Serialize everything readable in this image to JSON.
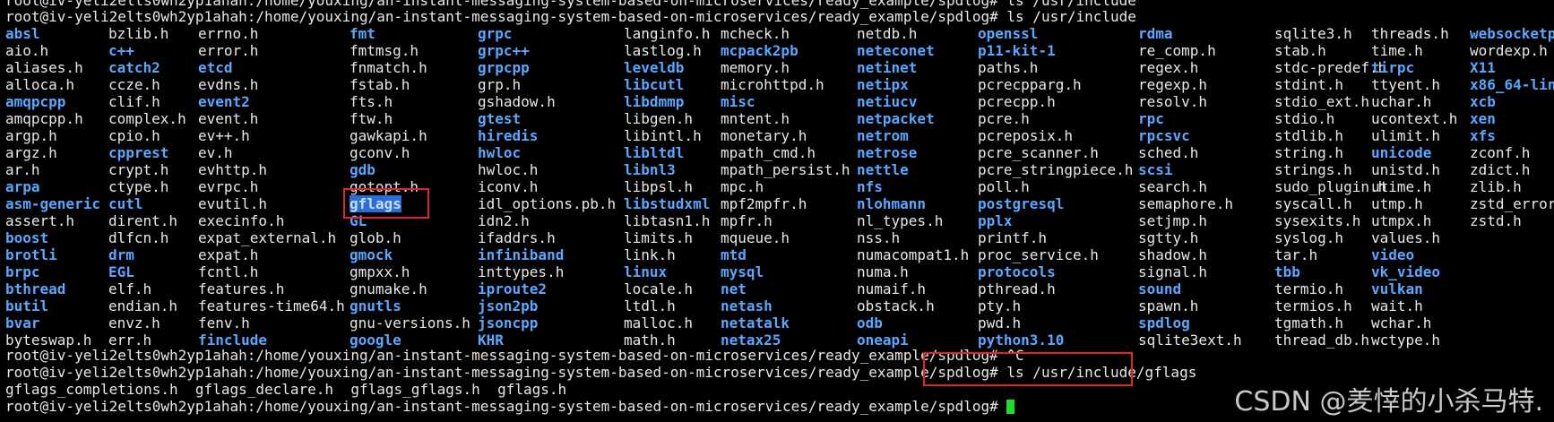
{
  "prompt_top_partial": "root@iv-yeli2elts0wh2yp1ahah:/home/youxing/an-instant-messaging-system-based-on-microservices/ready_example/spdlog# ls /usr/include",
  "prompt_ls_cmd": "root@iv-yeli2elts0wh2yp1ahah:/home/youxing/an-instant-messaging-system-based-on-microservices/ready_example/spdlog# ls /usr/include",
  "listing_columns": [
    [
      "absl",
      "aio.h",
      "aliases.h",
      "alloca.h",
      "amqpcpp",
      "amqpcpp.h",
      "argp.h",
      "argz.h",
      "ar.h",
      "arpa",
      "asm-generic",
      "assert.h",
      "boost",
      "brotli",
      "brpc",
      "bthread",
      "butil",
      "bvar",
      "byteswap.h"
    ],
    [
      "bzlib.h",
      "c++",
      "catch2",
      "ccze.h",
      "clif.h",
      "complex.h",
      "cpio.h",
      "cpprest",
      "crypt.h",
      "ctype.h",
      "cutl",
      "dirent.h",
      "dlfcn.h",
      "drm",
      "EGL",
      "elf.h",
      "endian.h",
      "envz.h",
      "err.h"
    ],
    [
      "errno.h",
      "error.h",
      "etcd",
      "evdns.h",
      "event2",
      "event.h",
      "ev++.h",
      "ev.h",
      "evhttp.h",
      "evrpc.h",
      "evutil.h",
      "execinfo.h",
      "expat_external.h",
      "expat.h",
      "fcntl.h",
      "features.h",
      "features-time64.h",
      "fenv.h",
      "finclude"
    ],
    [
      "fmt",
      "fmtmsg.h",
      "fnmatch.h",
      "fstab.h",
      "fts.h",
      "ftw.h",
      "gawkapi.h",
      "gconv.h",
      "gdb",
      "gotopt.h",
      "gflags",
      "GL",
      "glob.h",
      "gmock",
      "gmpxx.h",
      "gnumake.h",
      "gnutls",
      "gnu-versions.h",
      "google"
    ],
    [
      "grpc",
      "grpc++",
      "grpcpp",
      "grp.h",
      "gshadow.h",
      "gtest",
      "hiredis",
      "hwloc",
      "hwloc.h",
      "iconv.h",
      "idl_options.pb.h",
      "idn2.h",
      "ifaddrs.h",
      "infiniband",
      "inttypes.h",
      "iproute2",
      "json2pb",
      "jsoncpp",
      "KHR"
    ],
    [
      "langinfo.h",
      "lastlog.h",
      "leveldb",
      "libcutl",
      "libdmmp",
      "libgen.h",
      "libintl.h",
      "libltdl",
      "libnl3",
      "libpsl.h",
      "libstudxml",
      "libtasn1.h",
      "limits.h",
      "link.h",
      "linux",
      "locale.h",
      "ltdl.h",
      "malloc.h",
      "math.h"
    ],
    [
      "mcheck.h",
      "mcpack2pb",
      "memory.h",
      "microhttpd.h",
      "misc",
      "mntent.h",
      "monetary.h",
      "mpath_cmd.h",
      "mpath_persist.h",
      "mpc.h",
      "mpf2mpfr.h",
      "mpfr.h",
      "mqueue.h",
      "mtd",
      "mysql",
      "net",
      "netash",
      "netatalk",
      "netax25"
    ],
    [
      "netdb.h",
      "neteconet",
      "netinet",
      "netipx",
      "netiucv",
      "netpacket",
      "netrom",
      "netrose",
      "nettle",
      "nfs",
      "nlohmann",
      "nl_types.h",
      "nss.h",
      "numacompat1.h",
      "numa.h",
      "numaif.h",
      "obstack.h",
      "odb",
      "oneapi"
    ],
    [
      "openssl",
      "p11-kit-1",
      "paths.h",
      "pcrecpparg.h",
      "pcrecpp.h",
      "pcre.h",
      "pcreposix.h",
      "pcre_scanner.h",
      "pcre_stringpiece.h",
      "poll.h",
      "postgresql",
      "pplx",
      "printf.h",
      "proc_service.h",
      "protocols",
      "pthread.h",
      "pty.h",
      "pwd.h",
      "python3.10"
    ],
    [
      "rdma",
      "re_comp.h",
      "regex.h",
      "regexp.h",
      "resolv.h",
      "rpc",
      "rpcsvc",
      "sched.h",
      "scsi",
      "search.h",
      "semaphore.h",
      "setjmp.h",
      "sgtty.h",
      "shadow.h",
      "signal.h",
      "sound",
      "spawn.h",
      "spdlog",
      "sqlite3ext.h"
    ],
    [
      "sqlite3.h",
      "stab.h",
      "stdc-predef.h",
      "stdint.h",
      "stdio_ext.h",
      "stdio.h",
      "stdlib.h",
      "string.h",
      "strings.h",
      "sudo_plugin.h",
      "syscall.h",
      "sysexits.h",
      "syslog.h",
      "tar.h",
      "tbb",
      "termio.h",
      "termios.h",
      "tgmath.h",
      "thread_db.h"
    ],
    [
      "threads.h",
      "time.h",
      "tirpc",
      "ttyent.h",
      "uchar.h",
      "ucontext.h",
      "ulimit.h",
      "unicode",
      "unistd.h",
      "utime.h",
      "utmp.h",
      "utmpx.h",
      "values.h",
      "video",
      "vk_video",
      "vulkan",
      "wait.h",
      "wchar.h",
      "wctype.h"
    ],
    [
      "websocketpp",
      "wordexp.h",
      "X11",
      "x86_64-linux-gnu",
      "xcb",
      "xen",
      "xfs",
      "zconf.h",
      "zdict.h",
      "zlib.h",
      "zstd_errors.h",
      "zstd.h"
    ]
  ],
  "dir_entries": [
    "absl",
    "amqpcpp",
    "arpa",
    "asm-generic",
    "boost",
    "brotli",
    "brpc",
    "bthread",
    "butil",
    "bvar",
    "c++",
    "catch2",
    "cpprest",
    "cutl",
    "drm",
    "EGL",
    "etcd",
    "event2",
    "finclude",
    "fmt",
    "gdb",
    "gflags",
    "GL",
    "gmock",
    "gnutls",
    "google",
    "grpc",
    "grpc++",
    "grpcpp",
    "gtest",
    "hiredis",
    "hwloc",
    "infiniband",
    "iproute2",
    "json2pb",
    "jsoncpp",
    "KHR",
    "leveldb",
    "libcutl",
    "libdmmp",
    "libltdl",
    "libnl3",
    "libstudxml",
    "linux",
    "mcpack2pb",
    "misc",
    "mtd",
    "mysql",
    "net",
    "netash",
    "netatalk",
    "netax25",
    "neteconet",
    "netinet",
    "netipx",
    "netiucv",
    "netpacket",
    "netrom",
    "netrose",
    "nettle",
    "nfs",
    "nlohmann",
    "odb",
    "oneapi",
    "openssl",
    "p11-kit-1",
    "postgresql",
    "pplx",
    "protocols",
    "python3.10",
    "rdma",
    "rpc",
    "rpcsvc",
    "scsi",
    "sound",
    "spdlog",
    "tbb",
    "tirpc",
    "unicode",
    "video",
    "vk_video",
    "vulkan",
    "websocketpp",
    "X11",
    "x86_64-linux-gnu",
    "xcb",
    "xen",
    "xfs"
  ],
  "selected_entry": "gflags",
  "prompt_ctrl_c": "root@iv-yeli2elts0wh2yp1ahah:/home/youxing/an-instant-messaging-system-based-on-microservices/ready_example/spdlog# ^C",
  "prompt_ls_gflags": "root@iv-yeli2elts0wh2yp1ahah:/home/youxing/an-instant-messaging-system-based-on-microservices/ready_example/spdlog# ls /usr/include/gflags",
  "gflags_listing": "gflags_completions.h  gflags_declare.h  gflags_gflags.h  gflags.h",
  "prompt_final": "root@iv-yeli2elts0wh2yp1ahah:/home/youxing/an-instant-messaging-system-based-on-microservices/ready_example/spdlog# ",
  "watermark": "CSDN @羑悻的小杀马特.",
  "colors": {
    "background": "#000000",
    "text": "#e8e8e8",
    "directory": "#5aa7ff",
    "highlight_box": "#e0262b",
    "cursor": "#1adf2a",
    "selection": "#2f6bd6"
  }
}
